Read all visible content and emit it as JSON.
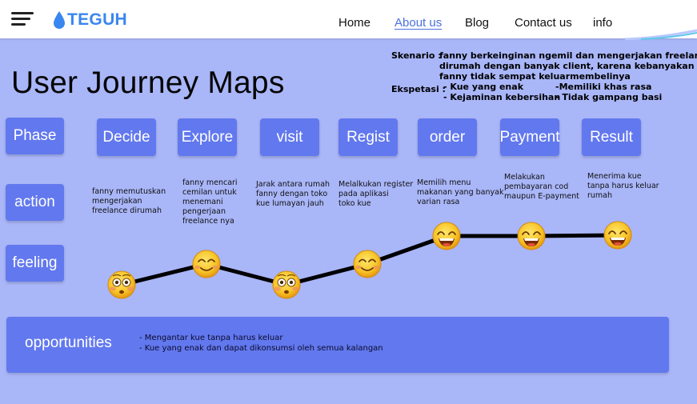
{
  "header": {
    "logo_text": "TEGUH",
    "nav": [
      "Home",
      "About us",
      "Blog",
      "Contact us",
      "info"
    ],
    "active_nav": "About us"
  },
  "page": {
    "title": "User Journey Maps"
  },
  "scenario": {
    "label": "Skenario :",
    "lines": [
      "fanny berkeinginan ngemil dan mengerjakan freelancenya",
      "dirumah dengan banyak client, karena kebanyakan projek",
      "fanny tidak sempat keluarmembelinya"
    ]
  },
  "expectation": {
    "label": "Ekspetasi :",
    "left": [
      "- Kue yang enak",
      "- Kejaminan kebersihan"
    ],
    "right": [
      "-Memiliki khas rasa",
      "- Tidak gampang basi"
    ]
  },
  "rows": {
    "phase": "Phase",
    "action": "action",
    "feeling": "feeling"
  },
  "phases": [
    {
      "label": "Decide",
      "action": [
        "fanny memutuskan",
        "mengerjakan",
        "freelance dirumah"
      ],
      "feeling": "flushed"
    },
    {
      "label": "Explore",
      "action": [
        "fanny mencari",
        "cemilan untuk",
        "menemani",
        "pengerjaan",
        "freelance nya"
      ],
      "feeling": "smile"
    },
    {
      "label": "visit",
      "action": [
        "Jarak antara rumah",
        "fanny dengan toko",
        "kue lumayan jauh"
      ],
      "feeling": "flushed"
    },
    {
      "label": "Regist",
      "action": [
        "Melalkukan register",
        "pada aplikasi",
        "toko kue"
      ],
      "feeling": "smile"
    },
    {
      "label": "order",
      "action": [
        "Memilih menu",
        "makanan yang banyak",
        "varian rasa"
      ],
      "feeling": "laugh"
    },
    {
      "label": "Payment",
      "action": [
        "Melakukan",
        "pembayaran cod",
        "maupun E-payment"
      ],
      "feeling": "laugh"
    },
    {
      "label": "Result",
      "action": [
        "Menerima kue",
        "tanpa harus keluar",
        "rumah"
      ],
      "feeling": "laugh"
    }
  ],
  "opportunities": {
    "label": "opportunities",
    "items": [
      "- Mengantar kue tanpa harus keluar",
      "- Kue yang enak dan dapat dikonsumsi oleh semua kalangan"
    ]
  },
  "colors": {
    "background": "#a9b6f8",
    "box": "#6278ee",
    "logo": "#3a86f0",
    "active_nav": "#4a6fe0",
    "emoji": "#f7c326"
  }
}
